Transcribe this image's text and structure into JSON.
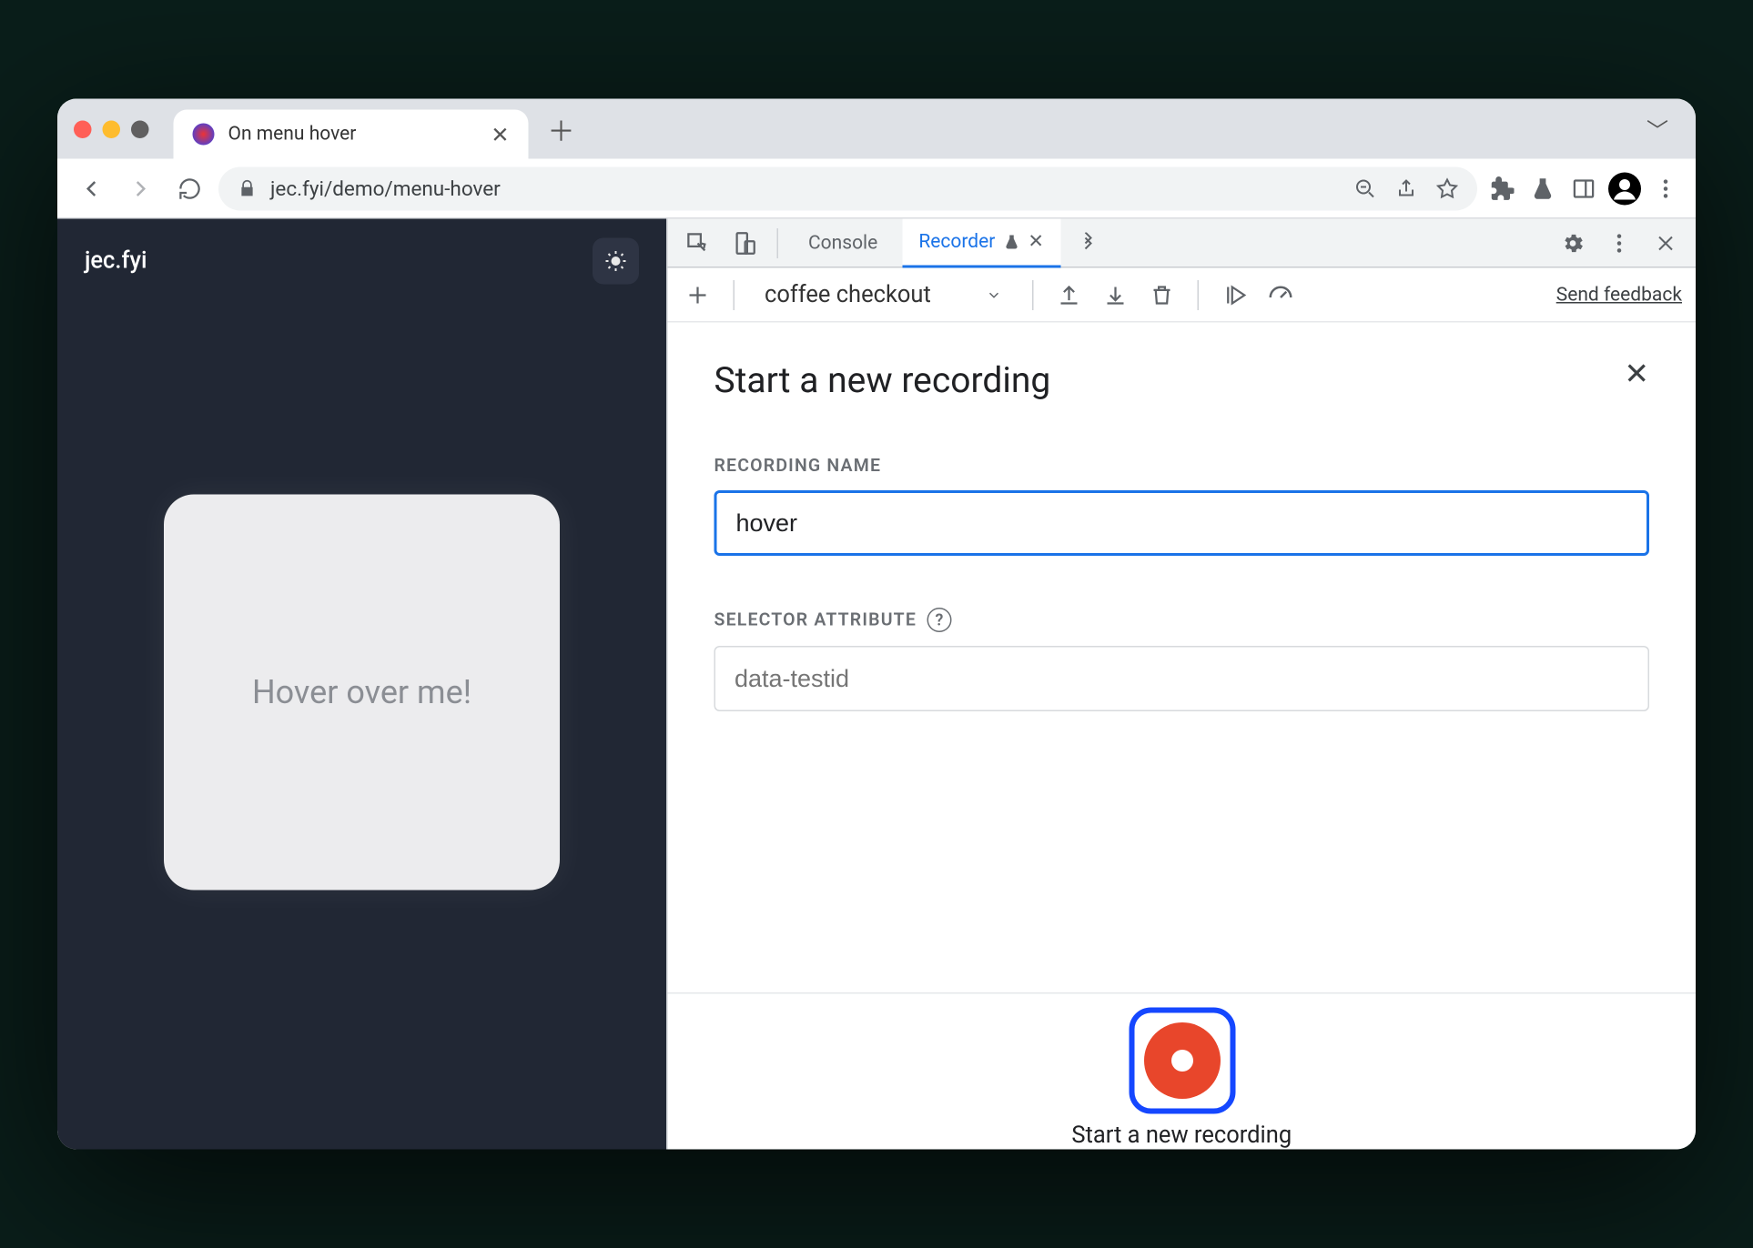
{
  "browser": {
    "tab_title": "On menu hover",
    "url_display": "jec.fyi/demo/menu-hover"
  },
  "page": {
    "site_title": "jec.fyi",
    "card_text": "Hover over me!"
  },
  "devtools": {
    "tabs": {
      "console": "Console",
      "recorder": "Recorder"
    },
    "selected_recording": "coffee checkout",
    "feedback_link": "Send feedback"
  },
  "recorder_form": {
    "heading": "Start a new recording",
    "name_label": "RECORDING NAME",
    "name_value": "hover",
    "selector_label": "SELECTOR ATTRIBUTE",
    "selector_placeholder": "data-testid",
    "record_label": "Start a new recording"
  }
}
